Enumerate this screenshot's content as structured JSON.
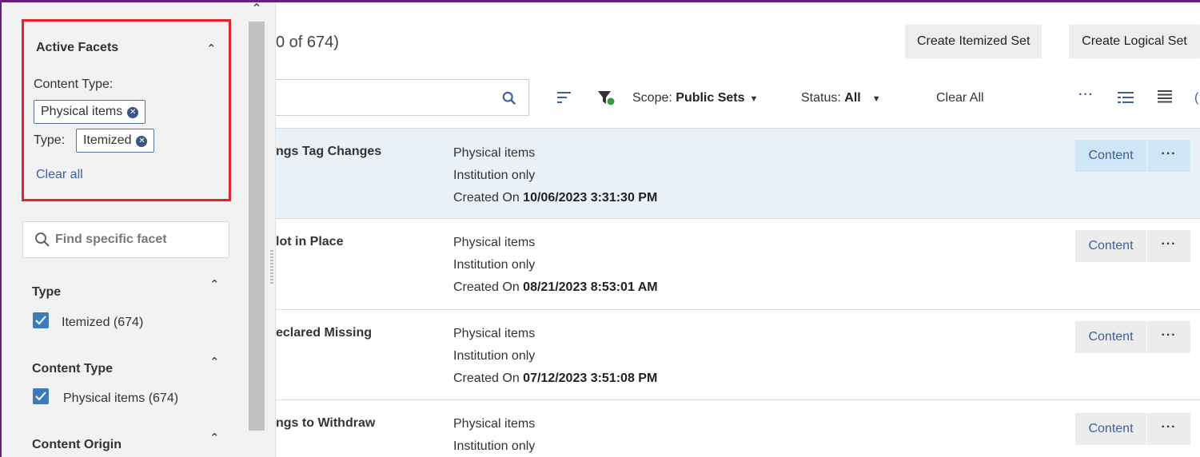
{
  "sidebar": {
    "active_facets": {
      "title": "Active Facets",
      "content_type_label": "Content Type:",
      "content_type_chip": "Physical items",
      "type_label": "Type:",
      "type_chip": "Itemized",
      "clear_all": "Clear all"
    },
    "facet_search": {
      "placeholder": "Find specific facet"
    },
    "groups": [
      {
        "title": "Type",
        "option": "Itemized (674)",
        "checked": true
      },
      {
        "title": "Content Type",
        "option": "Physical items (674)",
        "checked": true
      },
      {
        "title": "Content Origin"
      }
    ]
  },
  "main": {
    "count_text": "0 of 674)",
    "buttons": {
      "create_itemized": "Create Itemized Set",
      "create_logical": "Create Logical Set"
    },
    "toolbar": {
      "scope_label": "Scope:",
      "scope_value": "Public Sets",
      "status_label": "Status:",
      "status_value": "All",
      "clear_all": "Clear All"
    },
    "rows": [
      {
        "name": "ngs Tag Changes",
        "content_type": "Physical items",
        "visibility": "Institution only",
        "created_prefix": "Created On",
        "created": "10/06/2023 3:31:30 PM",
        "content_btn": "Content"
      },
      {
        "name": "lot in Place",
        "content_type": "Physical items",
        "visibility": "Institution only",
        "created_prefix": "Created On",
        "created": "08/21/2023 8:53:01 AM",
        "content_btn": "Content"
      },
      {
        "name": "eclared Missing",
        "content_type": "Physical items",
        "visibility": "Institution only",
        "created_prefix": "Created On",
        "created": "07/12/2023 3:51:08 PM",
        "content_btn": "Content"
      },
      {
        "name": "ngs to Withdraw",
        "content_type": "Physical items",
        "visibility": "Institution only",
        "content_btn": "Content"
      }
    ]
  },
  "colors": {
    "accent": "#3e5f9f",
    "highlight_box": "#e3222b",
    "frame": "#6b1f7c",
    "checkbox": "#3c7ab8"
  }
}
